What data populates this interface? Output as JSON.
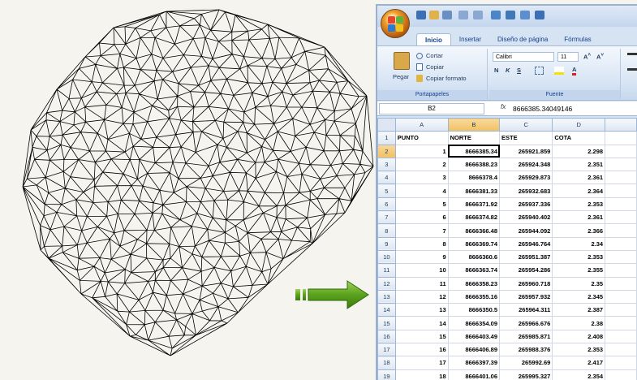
{
  "excel": {
    "tabs": [
      "Inicio",
      "Insertar",
      "Diseño de página",
      "Fórmulas"
    ],
    "active_tab": "Inicio",
    "ribbon": {
      "pegar": "Pegar",
      "cortar": "Cortar",
      "copiar": "Copiar",
      "copiar_formato": "Copiar formato",
      "portapapeles": "Portapapeles",
      "font_name": "Calibri",
      "font_size": "11",
      "fuente": "Fuente"
    },
    "name_box": "B2",
    "fx": "fx",
    "formula_value": "8666385.34049146",
    "columns": [
      "A",
      "B",
      "C",
      "D"
    ],
    "rows": [
      [
        "PUNTO",
        "NORTE",
        "ESTE",
        "COTA"
      ],
      [
        "1",
        "8666385.34",
        "265921.859",
        "2.298"
      ],
      [
        "2",
        "8666388.23",
        "265924.348",
        "2.351"
      ],
      [
        "3",
        "8666378.4",
        "265929.873",
        "2.361"
      ],
      [
        "4",
        "8666381.33",
        "265932.683",
        "2.364"
      ],
      [
        "5",
        "8666371.92",
        "265937.336",
        "2.353"
      ],
      [
        "6",
        "8666374.82",
        "265940.402",
        "2.361"
      ],
      [
        "7",
        "8666366.48",
        "265944.092",
        "2.366"
      ],
      [
        "8",
        "8666369.74",
        "265946.764",
        "2.34"
      ],
      [
        "9",
        "8666360.6",
        "265951.387",
        "2.353"
      ],
      [
        "10",
        "8666363.74",
        "265954.286",
        "2.355"
      ],
      [
        "11",
        "8666358.23",
        "265960.718",
        "2.35"
      ],
      [
        "12",
        "8666355.16",
        "265957.932",
        "2.345"
      ],
      [
        "13",
        "8666350.5",
        "265964.311",
        "2.387"
      ],
      [
        "14",
        "8666354.09",
        "265966.676",
        "2.38"
      ],
      [
        "15",
        "8666403.49",
        "265985.871",
        "2.408"
      ],
      [
        "16",
        "8666406.89",
        "265988.376",
        "2.353"
      ],
      [
        "17",
        "8666397.39",
        "265992.69",
        "2.417"
      ],
      [
        "18",
        "8666401.06",
        "265995.327",
        "2.354"
      ]
    ],
    "colors": {
      "accent": "#f1c15f",
      "grid": "#d0d7e5",
      "ribbon": "#d6e3f3"
    }
  },
  "arrow_color": "#5aa21c",
  "mesh_color": "#000000"
}
